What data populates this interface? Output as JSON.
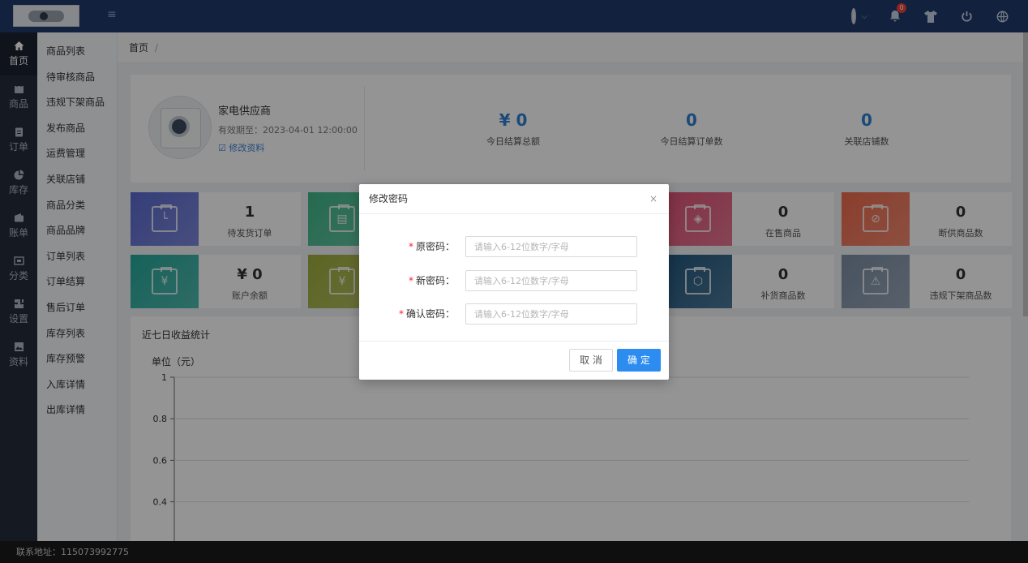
{
  "topbar": {
    "badge_count": "0"
  },
  "sidenav": {
    "items": [
      {
        "label": "首页"
      },
      {
        "label": "商品"
      },
      {
        "label": "订单"
      },
      {
        "label": "库存"
      },
      {
        "label": "账单"
      },
      {
        "label": "分类"
      },
      {
        "label": "设置"
      },
      {
        "label": "资料"
      }
    ]
  },
  "submenu": {
    "items": [
      {
        "label": "商品列表"
      },
      {
        "label": "待审核商品"
      },
      {
        "label": "违规下架商品"
      },
      {
        "label": "发布商品"
      },
      {
        "label": "运费管理"
      },
      {
        "label": "关联店铺"
      },
      {
        "label": "商品分类"
      },
      {
        "label": "商品品牌"
      },
      {
        "label": "订单列表"
      },
      {
        "label": "订单结算"
      },
      {
        "label": "售后订单"
      },
      {
        "label": "库存列表"
      },
      {
        "label": "库存预警"
      },
      {
        "label": "入库详情"
      },
      {
        "label": "出库详情"
      }
    ]
  },
  "breadcrumb": {
    "home": "首页",
    "separator": "/"
  },
  "supplier": {
    "name": "家电供应商",
    "valid_until": "有效期至：2023-04-01 12:00:00",
    "edit_link": "修改资料"
  },
  "stats": [
    {
      "value": "¥ 0",
      "label": "今日结算总额"
    },
    {
      "value": "0",
      "label": "今日结算订单数"
    },
    {
      "value": "0",
      "label": "关联店铺数"
    }
  ],
  "cards": [
    {
      "value": "1",
      "label": "待发货订单",
      "color": "#5b6ad0"
    },
    {
      "value": "",
      "label": "",
      "color": "#3fb78a"
    },
    {
      "value": "0",
      "label": "在售商品",
      "color": "#e05476"
    },
    {
      "value": "0",
      "label": "断供商品数",
      "color": "#ee6b4d"
    },
    {
      "value": "¥ 0",
      "label": "账户余额",
      "color": "#25a99b"
    },
    {
      "value": "",
      "label": "",
      "color": "#9fae3c"
    },
    {
      "value": "0",
      "label": "补货商品数",
      "color": "#21577f"
    },
    {
      "value": "0",
      "label": "违规下架商品数",
      "color": "#7d8fa5"
    }
  ],
  "chart": {
    "title": "近七日收益统计",
    "unit_label": "单位（元）"
  },
  "chart_data": {
    "type": "line",
    "title": "近七日收益统计",
    "ylabel": "单位（元）",
    "ylim": [
      0,
      1
    ],
    "yticks": [
      "1",
      "0.8",
      "0.6",
      "0.4",
      "0.2"
    ],
    "series": [],
    "grid": true
  },
  "modal": {
    "title": "修改密码",
    "close": "×",
    "fields": [
      {
        "label": "原密码：",
        "placeholder": "请输入6-12位数字/字母",
        "value": ""
      },
      {
        "label": "新密码：",
        "placeholder": "请输入6-12位数字/字母",
        "value": ""
      },
      {
        "label": "确认密码：",
        "placeholder": "请输入6-12位数字/字母",
        "value": ""
      }
    ],
    "required_mark": "*",
    "cancel": "取 消",
    "ok": "确 定"
  },
  "footer": {
    "text": "联系地址：115073992775"
  }
}
